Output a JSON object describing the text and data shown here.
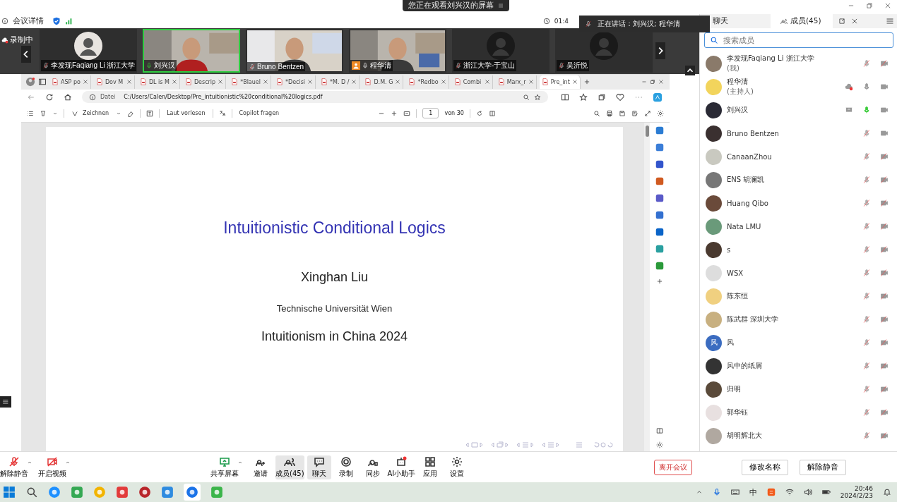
{
  "top_bar": {
    "screen_notice": "您正在观看刘兴汉的屏幕"
  },
  "info_bar": {
    "details": "会议详情",
    "timer": "01:4"
  },
  "speaking_overlay": {
    "text": "正在讲话：刘兴汉; 程华清"
  },
  "video_strip": {
    "recording": "录制中",
    "tiles": [
      {
        "name": "李发现Faqiang Li 浙江大学",
        "muted": true,
        "speaking": false,
        "kind": "avatar",
        "host": false
      },
      {
        "name": "刘兴汉",
        "muted": false,
        "speaking": true,
        "kind": "video",
        "host": false
      },
      {
        "name": "Bruno Bentzen",
        "muted": true,
        "speaking": false,
        "kind": "video",
        "host": false
      },
      {
        "name": "程华清",
        "muted": false,
        "speaking": false,
        "kind": "video",
        "host": true
      },
      {
        "name": "浙江大学-于宝山",
        "muted": true,
        "speaking": false,
        "kind": "avatar",
        "host": false
      },
      {
        "name": "吴沂悦",
        "muted": true,
        "speaking": false,
        "kind": "avatar",
        "host": false
      }
    ]
  },
  "browser": {
    "tabs": [
      {
        "label": "ASP po",
        "selected": false
      },
      {
        "label": "Dov M",
        "selected": false
      },
      {
        "label": "DL is M",
        "selected": false
      },
      {
        "label": "Descrip",
        "selected": false
      },
      {
        "label": "*Blauel",
        "selected": false
      },
      {
        "label": "*Decisi",
        "selected": false
      },
      {
        "label": "*M. D /",
        "selected": false
      },
      {
        "label": "D.M. G",
        "selected": false
      },
      {
        "label": "*Redbo",
        "selected": false
      },
      {
        "label": "Combi",
        "selected": false
      },
      {
        "label": "Marx_r",
        "selected": false
      },
      {
        "label": "Pre_int",
        "selected": true
      }
    ],
    "address": {
      "scheme": "Datei",
      "url": "C:/Users/Calen/Desktop/Pre_intuitionistic%20conditional%20logics.pdf"
    },
    "pdf_toolbar": {
      "draw": "Zeichnen",
      "read_aloud": "Laut vorlesen",
      "copilot": "Copilot fragen",
      "page": "1",
      "page_count": "von 30"
    },
    "pdf_page": {
      "title": "Intuitionistic Conditional Logics",
      "author": "Xinghan Liu",
      "affiliation": "Technische Universität Wien",
      "event": "Intuitionism in China 2024"
    }
  },
  "panel": {
    "tabs": [
      {
        "label": "聊天",
        "selected": false
      },
      {
        "label": "成员(45)",
        "selected": true
      }
    ],
    "search": {
      "placeholder": "搜索成员"
    },
    "members": [
      {
        "name": "李发现Faqiang Li 浙江大学",
        "note": "(我)",
        "muted": true,
        "speaking": false,
        "camera_on": false,
        "recording": false,
        "sharing": false,
        "color": "#8a7a6a"
      },
      {
        "name": "程华清",
        "note": "(主持人)",
        "muted": false,
        "speaking": false,
        "camera_on": true,
        "recording": true,
        "sharing": false,
        "color": "#f2d45c"
      },
      {
        "name": "刘兴汉",
        "muted": false,
        "speaking": true,
        "camera_on": true,
        "recording": false,
        "sharing": true,
        "color": "#2a2a35"
      },
      {
        "name": "Bruno Bentzen",
        "muted": true,
        "speaking": false,
        "camera_on": true,
        "recording": false,
        "sharing": false,
        "color": "#3a3030"
      },
      {
        "name": "CanaanZhou",
        "muted": true,
        "speaking": false,
        "camera_on": false,
        "recording": false,
        "sharing": false,
        "color": "#c9c9c0"
      },
      {
        "name": "ENS 胡澜凯",
        "muted": true,
        "speaking": false,
        "camera_on": false,
        "recording": false,
        "sharing": false,
        "color": "#777777"
      },
      {
        "name": "Huang Qibo",
        "muted": true,
        "speaking": false,
        "camera_on": false,
        "recording": false,
        "sharing": false,
        "color": "#6a4a3a"
      },
      {
        "name": "Nata LMU",
        "muted": true,
        "speaking": false,
        "camera_on": false,
        "recording": false,
        "sharing": false,
        "color": "#6a9a7a"
      },
      {
        "name": "s",
        "muted": true,
        "speaking": false,
        "camera_on": false,
        "recording": false,
        "sharing": false,
        "color": "#4a3a30"
      },
      {
        "name": "WSX",
        "muted": true,
        "speaking": false,
        "camera_on": false,
        "recording": false,
        "sharing": false,
        "color": "#dddddd"
      },
      {
        "name": "陈东恒",
        "muted": true,
        "speaking": false,
        "camera_on": false,
        "recording": false,
        "sharing": false,
        "color": "#f0d080"
      },
      {
        "name": "陈武群 深圳大学",
        "muted": true,
        "speaking": false,
        "camera_on": false,
        "recording": false,
        "sharing": false,
        "color": "#c8b080"
      },
      {
        "name": "风",
        "avatar_text": "风",
        "muted": true,
        "speaking": false,
        "camera_on": false,
        "recording": false,
        "sharing": false,
        "color": "#3b6cc0"
      },
      {
        "name": "风中的纸屑",
        "muted": true,
        "speaking": false,
        "camera_on": false,
        "recording": false,
        "sharing": false,
        "color": "#333333"
      },
      {
        "name": "归明",
        "muted": true,
        "speaking": false,
        "camera_on": false,
        "recording": false,
        "sharing": false,
        "color": "#5a4a3a"
      },
      {
        "name": "郭华钰",
        "muted": true,
        "speaking": false,
        "camera_on": false,
        "recording": false,
        "sharing": false,
        "color": "#e8e0e0"
      },
      {
        "name": "胡明辉北大",
        "muted": true,
        "speaking": false,
        "camera_on": false,
        "recording": false,
        "sharing": false,
        "color": "#b0a8a0"
      }
    ],
    "buttons": [
      "修改名称",
      "解除静音"
    ]
  },
  "toolbar": {
    "items": [
      {
        "label": "解除静音",
        "kind": "mic",
        "selected": false
      },
      {
        "label": "开启视频",
        "kind": "camera",
        "selected": false
      },
      {
        "label": "共享屏幕",
        "kind": "share",
        "selected": false
      },
      {
        "label": "邀请",
        "kind": "invite",
        "selected": false
      },
      {
        "label": "成员(45)",
        "kind": "members",
        "selected": true
      },
      {
        "label": "聊天",
        "kind": "chat",
        "selected": true
      },
      {
        "label": "录制",
        "kind": "record",
        "selected": false
      },
      {
        "label": "同步",
        "kind": "sync",
        "selected": false
      },
      {
        "label": "AI小助手",
        "kind": "ai",
        "selected": false
      },
      {
        "label": "应用",
        "kind": "apps",
        "selected": false
      },
      {
        "label": "设置",
        "kind": "settings",
        "selected": false
      }
    ],
    "leave": "离开会议"
  },
  "taskbar": {
    "input_mode": "中",
    "time": "20:46",
    "date": "2024/2/23"
  }
}
